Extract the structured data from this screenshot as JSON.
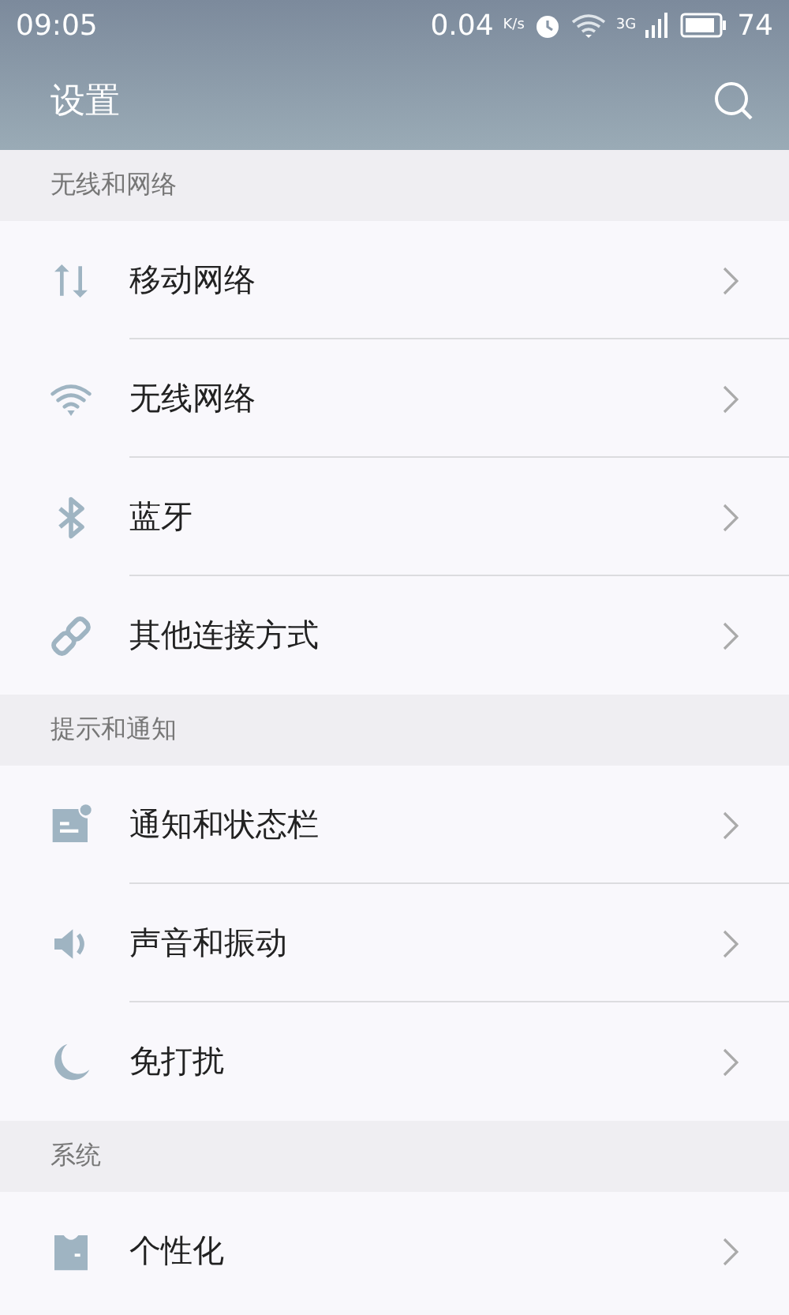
{
  "status_bar": {
    "time": "09:05",
    "speed": "0.04",
    "speed_unit": "K/s",
    "network_type": "3G",
    "battery": "74"
  },
  "header": {
    "title": "设置"
  },
  "sections": [
    {
      "title": "无线和网络",
      "items": [
        {
          "label": "移动网络",
          "kind": "data"
        },
        {
          "label": "无线网络",
          "kind": "wifi"
        },
        {
          "label": "蓝牙",
          "kind": "bluetooth"
        },
        {
          "label": "其他连接方式",
          "kind": "link"
        }
      ]
    },
    {
      "title": "提示和通知",
      "items": [
        {
          "label": "通知和状态栏",
          "kind": "notification"
        },
        {
          "label": "声音和振动",
          "kind": "sound"
        },
        {
          "label": "免打扰",
          "kind": "moon"
        }
      ]
    },
    {
      "title": "系统",
      "items": [
        {
          "label": "个性化",
          "kind": "shirt"
        }
      ]
    }
  ]
}
